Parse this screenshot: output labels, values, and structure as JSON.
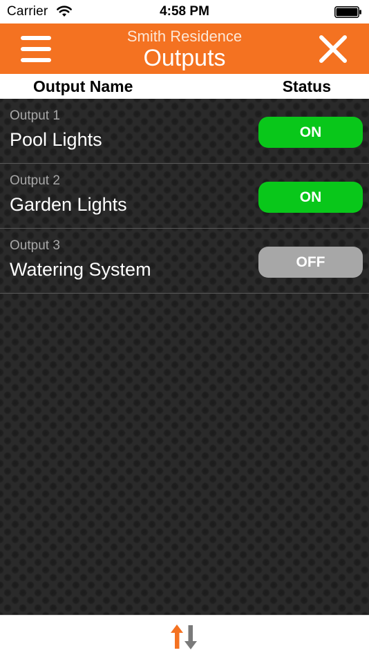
{
  "status_bar": {
    "carrier": "Carrier",
    "time": "4:58 PM",
    "wifi_icon": "wifi-icon",
    "battery_icon": "battery-icon"
  },
  "nav": {
    "subtitle": "Smith Residence",
    "title": "Outputs",
    "menu_icon": "hamburger-menu-icon",
    "close_icon": "close-icon",
    "color": "#f47221"
  },
  "columns": {
    "name": "Output Name",
    "status": "Status"
  },
  "outputs": [
    {
      "label": "Output 1",
      "name": "Pool Lights",
      "status": "ON"
    },
    {
      "label": "Output 2",
      "name": "Garden Lights",
      "status": "ON"
    },
    {
      "label": "Output 3",
      "name": "Watering System",
      "status": "OFF"
    }
  ],
  "colors": {
    "on": "#09c71a",
    "off": "#a7a7a7",
    "accent": "#f47221"
  },
  "bottom_bar": {
    "icon": "sync-arrows-icon"
  }
}
